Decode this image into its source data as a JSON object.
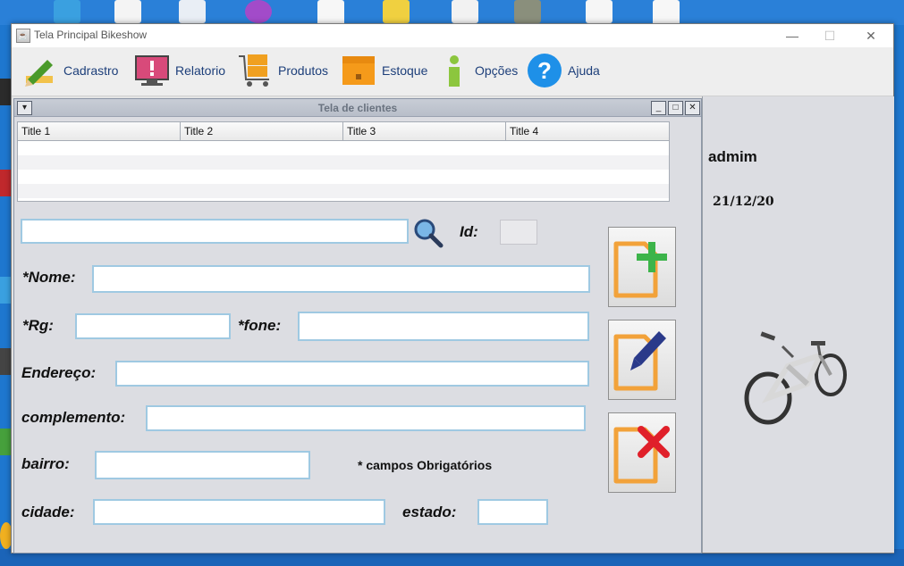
{
  "window": {
    "title": "Tela Principal Bikeshow"
  },
  "menu": {
    "items": [
      {
        "label": "Cadrastro",
        "icon": "pencil-icon"
      },
      {
        "label": "Relatorio",
        "icon": "monitor-alert-icon"
      },
      {
        "label": "Produtos",
        "icon": "cart-boxes-icon"
      },
      {
        "label": "Estoque",
        "icon": "box-icon"
      },
      {
        "label": "Opções",
        "icon": "info-icon"
      },
      {
        "label": "Ajuda",
        "icon": "help-icon"
      }
    ]
  },
  "internal_frame": {
    "title": "Tela de clientes"
  },
  "table": {
    "columns": [
      "Title 1",
      "Title 2",
      "Title 3",
      "Title 4"
    ]
  },
  "form": {
    "id_label": "Id:",
    "nome_label": "*Nome:",
    "rg_label": "*Rg:",
    "fone_label": "*fone:",
    "endereco_label": "Endereço:",
    "complemento_label": "complemento:",
    "bairro_label": "bairro:",
    "cidade_label": "cidade:",
    "estado_label": "estado:",
    "required_note": "* campos Obrigatórios"
  },
  "side": {
    "user": "admim",
    "date": "21/12/20"
  },
  "colors": {
    "menu_text": "#1d3f7a",
    "field_border": "#9fc9e2",
    "add": "#3cb44a",
    "remove": "#e0202a",
    "doc_orange": "#f2a23a"
  }
}
